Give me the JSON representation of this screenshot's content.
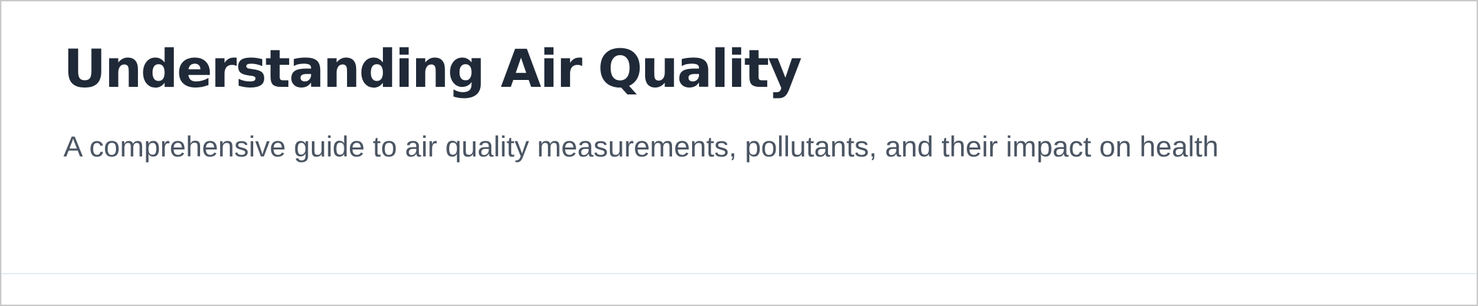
{
  "hero": {
    "title": "Understanding Air Quality",
    "subtitle": "A comprehensive guide to air quality measurements, pollutants, and their impact on health"
  },
  "colors": {
    "title": "#1f2937",
    "subtitle": "#4b5563",
    "divider": "#e4edf3",
    "background": "#ffffff"
  }
}
